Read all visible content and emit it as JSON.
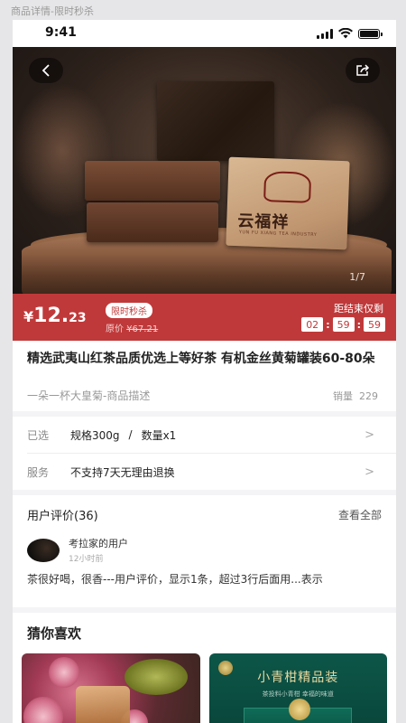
{
  "page_caption": "商品详情-限时秒杀",
  "status_bar": {
    "time": "9:41"
  },
  "hero": {
    "pager": "1/7",
    "package_text": "云福祥",
    "package_sub": "YUN FU XIANG TEA INDUSTRY",
    "icons": {
      "back": "back-arrow-icon",
      "share": "share-icon"
    }
  },
  "price_bar": {
    "currency": "¥",
    "price_int": "12.",
    "price_dec": "23",
    "tag": "限时秒杀",
    "original_label": "原价",
    "original_price": "¥67.21",
    "countdown_label": "距结束仅剩",
    "countdown": {
      "h": "02",
      "m": "59",
      "s": "59"
    },
    "color": "#c0393a"
  },
  "product": {
    "title": "精选武夷山红茶品质优选上等好茶 有机金丝黄菊罐装60-80朵",
    "subtitle": "一朵一杯大皇菊-商品描述",
    "sales_label": "销量",
    "sales": "229"
  },
  "selection": {
    "label": "已选",
    "spec": "规格300g",
    "sep": "/",
    "qty": "数量x1"
  },
  "service": {
    "label": "服务",
    "value": "不支持7天无理由退换"
  },
  "reviews": {
    "title": "用户评价(36)",
    "view_all": "查看全部",
    "user": "考拉家的用户",
    "time": "12小时前",
    "text": "茶很好喝，很香---用户评价，显示1条，超过3行后面用...表示"
  },
  "guess": {
    "title": "猜你喜欢",
    "items": [
      {
        "name": "flower-tea-product"
      },
      {
        "name": "citrus-tea-product",
        "title": "小青柑精品装",
        "sub": "茶投料小青柑 幸福的味道"
      }
    ]
  }
}
